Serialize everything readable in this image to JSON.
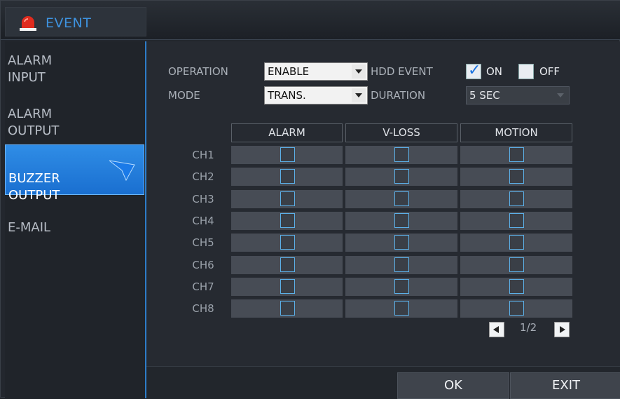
{
  "window": {
    "title": "EVENT",
    "title_icon": "alarm-siren-icon",
    "accent": "#3e93e0"
  },
  "sidebar": {
    "items": [
      {
        "label": "ALARM\nINPUT",
        "active": false
      },
      {
        "label": "ALARM\nOUTPUT",
        "active": false
      },
      {
        "label": "BUZZER\nOUTPUT",
        "active": true
      },
      {
        "label": "E-MAIL",
        "active": false
      }
    ]
  },
  "settings": {
    "operation": {
      "label": "OPERATION",
      "value": "ENABLE"
    },
    "mode": {
      "label": "MODE",
      "value": "TRANS."
    },
    "hdd_event": {
      "label": "HDD EVENT",
      "on_label": "ON",
      "on_checked": true,
      "off_label": "OFF",
      "off_checked": false
    },
    "duration": {
      "label": "DURATION",
      "value": "5 SEC"
    }
  },
  "grid": {
    "columns": [
      "ALARM",
      "V-LOSS",
      "MOTION"
    ],
    "rows": [
      "CH1",
      "CH2",
      "CH3",
      "CH4",
      "CH5",
      "CH6",
      "CH7",
      "CH8"
    ]
  },
  "pager": {
    "text": "1/2"
  },
  "footer": {
    "ok_label": "OK",
    "exit_label": "EXIT"
  }
}
